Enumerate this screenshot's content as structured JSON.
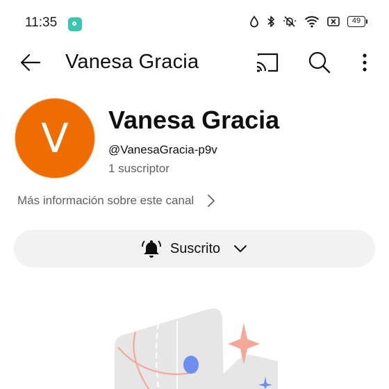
{
  "status_bar": {
    "time": "11:35",
    "battery": "49",
    "icons": [
      "notification-app-icon",
      "water-drop-icon",
      "bluetooth-icon",
      "mute-bell-icon",
      "wifi-icon",
      "nfc-icon",
      "battery-icon"
    ]
  },
  "app_bar": {
    "title": "Vanesa Gracia",
    "icons": [
      "back-arrow-icon",
      "cast-icon",
      "search-icon",
      "more-vert-icon"
    ]
  },
  "channel": {
    "avatar_letter": "V",
    "avatar_color": "#ef6c00",
    "name": "Vanesa Gracia",
    "handle": "@VanesaGracia-p9v",
    "subscribers": "1 suscriptor"
  },
  "more_info": {
    "label": "Más información sobre este canal"
  },
  "subscribe": {
    "label": "Suscrito",
    "button_bg": "#f2f2f2"
  },
  "colors": {
    "text_primary": "#0f0f0f",
    "text_secondary": "#606060",
    "illustration_gray": "#e6e6e6",
    "illustration_salmon": "#f4a89a",
    "illustration_blue": "#6e8ff0"
  }
}
